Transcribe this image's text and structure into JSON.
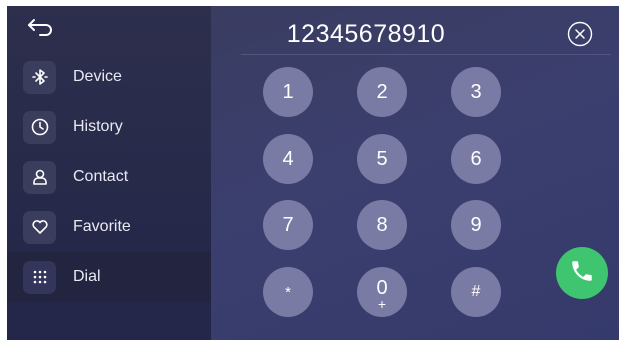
{
  "sidebar": {
    "back_icon": "back-arrow-icon",
    "items": [
      {
        "label": "Device",
        "icon": "bluetooth-icon",
        "active": false
      },
      {
        "label": "History",
        "icon": "clock-icon",
        "active": false
      },
      {
        "label": "Contact",
        "icon": "person-icon",
        "active": false
      },
      {
        "label": "Favorite",
        "icon": "heart-icon",
        "active": false
      },
      {
        "label": "Dial",
        "icon": "keypad-icon",
        "active": true
      }
    ]
  },
  "dialer": {
    "number": "12345678910",
    "clear_icon": "clear-circle-x-icon",
    "keys": [
      {
        "label": "1"
      },
      {
        "label": "2"
      },
      {
        "label": "3"
      },
      {
        "label": "4"
      },
      {
        "label": "5"
      },
      {
        "label": "6"
      },
      {
        "label": "7"
      },
      {
        "label": "8"
      },
      {
        "label": "9"
      },
      {
        "label": "*"
      },
      {
        "label": "0",
        "sub": "+"
      },
      {
        "label": "#"
      }
    ],
    "call_icon": "phone-icon"
  },
  "colors": {
    "sidebar_bg": "#2b2d4b",
    "active_item_bg": "#222440",
    "key_bg": "#7a7ba4",
    "call_green": "#3fc46f"
  }
}
